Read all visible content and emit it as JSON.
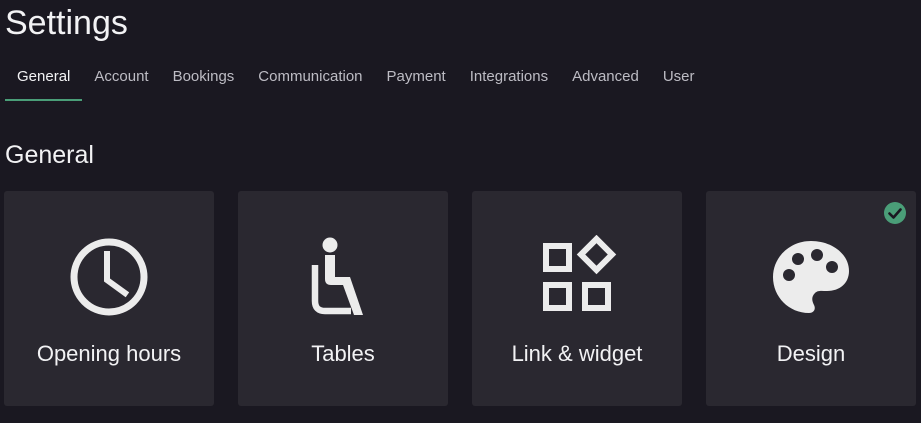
{
  "header": {
    "title": "Settings"
  },
  "tabs": [
    {
      "label": "General",
      "active": true
    },
    {
      "label": "Account",
      "active": false
    },
    {
      "label": "Bookings",
      "active": false
    },
    {
      "label": "Communication",
      "active": false
    },
    {
      "label": "Payment",
      "active": false
    },
    {
      "label": "Integrations",
      "active": false
    },
    {
      "label": "Advanced",
      "active": false
    },
    {
      "label": "User",
      "active": false
    }
  ],
  "section": {
    "title": "General"
  },
  "cards": [
    {
      "label": "Opening hours",
      "icon": "clock-icon"
    },
    {
      "label": "Tables",
      "icon": "seated-person-icon"
    },
    {
      "label": "Link & widget",
      "icon": "widgets-icon"
    },
    {
      "label": "Design",
      "icon": "palette-icon",
      "status": "completed"
    }
  ],
  "colors": {
    "background": "#1a1821",
    "card": "#2a2830",
    "accent": "#4a9e78",
    "icon": "#ececec"
  }
}
